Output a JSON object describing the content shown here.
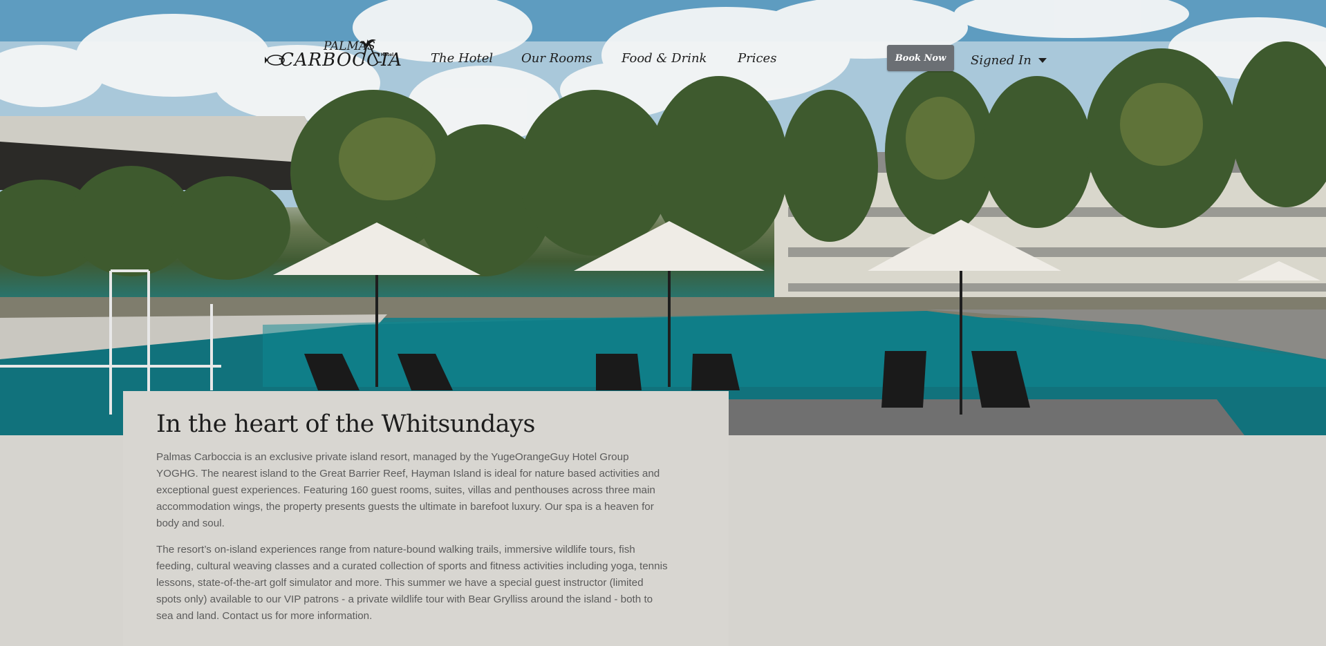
{
  "nav": {
    "logo": {
      "text_main": "CARBOCCIA",
      "text_top": "PALMAS",
      "text_small": "Hotel"
    },
    "links": [
      {
        "label": "The Hotel"
      },
      {
        "label": "Our Rooms"
      },
      {
        "label": "Food & Drink"
      },
      {
        "label": "Prices"
      }
    ],
    "book_now_label": "Book Now",
    "account_label": "Signed In"
  },
  "content": {
    "title": "In the heart of the Whitsundays",
    "paragraphs": [
      "Palmas Carboccia is an exclusive private island resort, managed by the YugeOrangeGuy Hotel Group YOGHG. The nearest island to the Great Barrier Reef, Hayman Island is ideal for nature based activities and exceptional guest experiences. Featuring 160 guest rooms, suites, villas and penthouses across three main accommodation wings, the property presents guests the ultimate in barefoot luxury. Our spa is a heaven for body and soul.",
      "The resort’s on-island experiences range from nature-bound walking trails, immersive wildlife tours, fish feeding, cultural weaving classes and a curated collection of sports and fitness activities including yoga, tennis lessons, state-of-the-art golf simulator and more. This summer we have a special guest instructor (limited spots only) available to our VIP patrons - a private wildlife tour with Bear Grylliss around the island - both to sea and land. Contact us for more information."
    ]
  },
  "hero": {
    "description_icon": "pool-resort-photo",
    "colors": {
      "sky": "#8fb8d0",
      "pool": "#11727c",
      "foliage": "#3f5a32",
      "building": "#d9d7cc"
    }
  }
}
